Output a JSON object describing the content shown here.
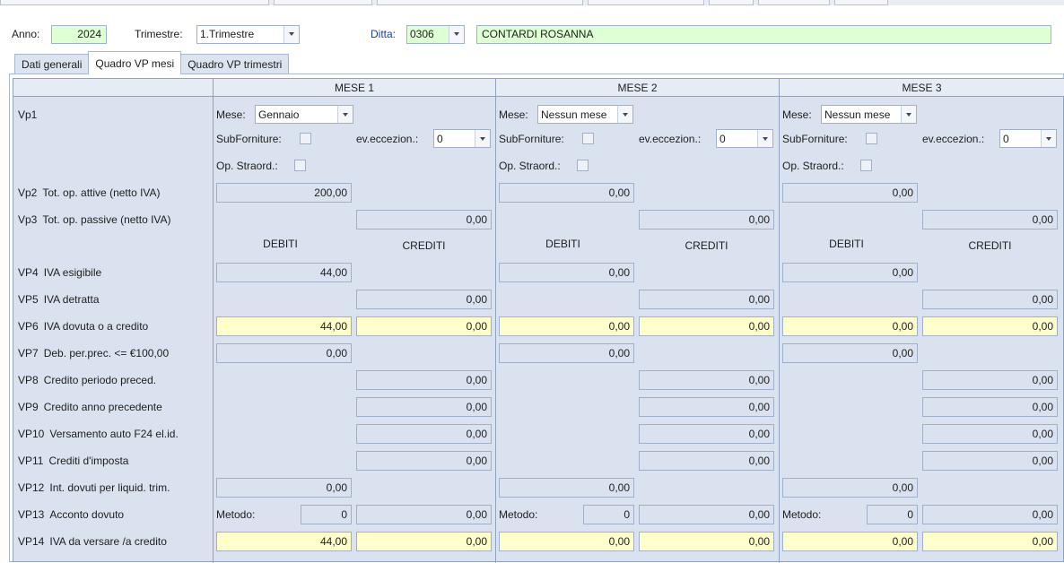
{
  "header": {
    "anno_label": "Anno:",
    "anno_value": "2024",
    "trimestre_label": "Trimestre:",
    "trimestre_value": "1.Trimestre",
    "ditta_label": "Ditta:",
    "ditta_code": "0306",
    "ditta_name": "CONTARDI ROSANNA"
  },
  "tabs": [
    {
      "label": "Dati generali"
    },
    {
      "label": "Quadro VP mesi"
    },
    {
      "label": "Quadro VP trimestri"
    }
  ],
  "active_tab": "Quadro VP mesi",
  "columns": [
    {
      "title": "MESE 1",
      "mese": "Gennaio",
      "eveccezion": "0",
      "metodo": "0",
      "vp2": "200,00",
      "vp3": "0,00",
      "vp4": "44,00",
      "vp5": "0,00",
      "vp6d": "44,00",
      "vp6c": "0,00",
      "vp7": "0,00",
      "vp8": "0,00",
      "vp9": "0,00",
      "vp10": "0,00",
      "vp11": "0,00",
      "vp12": "0,00",
      "vp13": "0,00",
      "vp14d": "44,00",
      "vp14c": "0,00"
    },
    {
      "title": "MESE 2",
      "mese": "Nessun mese",
      "eveccezion": "0",
      "metodo": "0",
      "vp2": "0,00",
      "vp3": "0,00",
      "vp4": "0,00",
      "vp5": "0,00",
      "vp6d": "0,00",
      "vp6c": "0,00",
      "vp7": "0,00",
      "vp8": "0,00",
      "vp9": "0,00",
      "vp10": "0,00",
      "vp11": "0,00",
      "vp12": "0,00",
      "vp13": "0,00",
      "vp14d": "0,00",
      "vp14c": "0,00"
    },
    {
      "title": "MESE 3",
      "mese": "Nessun mese",
      "eveccezion": "0",
      "metodo": "0",
      "vp2": "0,00",
      "vp3": "0,00",
      "vp4": "0,00",
      "vp5": "0,00",
      "vp6d": "0,00",
      "vp6c": "0,00",
      "vp7": "0,00",
      "vp8": "0,00",
      "vp9": "0,00",
      "vp10": "0,00",
      "vp11": "0,00",
      "vp12": "0,00",
      "vp13": "0,00",
      "vp14d": "0,00",
      "vp14c": "0,00"
    }
  ],
  "field_labels": {
    "mese": "Mese:",
    "subforniture": "SubForniture:",
    "eveccezion": "ev.eccezion.:",
    "opstraord": "Op. Straord.:",
    "metodo": "Metodo:",
    "debiti": "DEBITI",
    "crediti": "CREDITI"
  },
  "rows": [
    {
      "code": "Vp1",
      "label": ""
    },
    {
      "code": "Vp2",
      "label": "Tot. op. attive (netto IVA)"
    },
    {
      "code": "Vp3",
      "label": "Tot. op. passive (netto IVA)"
    },
    {
      "code": "VP4",
      "label": "IVA esigibile"
    },
    {
      "code": "VP5",
      "label": "IVA detratta"
    },
    {
      "code": "VP6",
      "label": "IVA dovuta o a credito"
    },
    {
      "code": "VP7",
      "label": "Deb. per.prec. <= €100,00"
    },
    {
      "code": "VP8",
      "label": "Credito periodo preced."
    },
    {
      "code": "VP9",
      "label": "Credito anno precedente"
    },
    {
      "code": "VP10",
      "label": "Versamento auto F24 el.id."
    },
    {
      "code": "VP11",
      "label": "Crediti d'imposta"
    },
    {
      "code": "VP12",
      "label": "Int. dovuti per liquid. trim."
    },
    {
      "code": "VP13",
      "label": "Acconto dovuto"
    },
    {
      "code": "VP14",
      "label": "IVA da versare /a credito"
    }
  ],
  "icons": {
    "dropdown": "chevron-down-icon",
    "checkbox": "checkbox-icon"
  },
  "colors": {
    "green_field": "#dfffd4",
    "yellow_field": "#ffffcc",
    "grid_bg": "#d9e2ee",
    "blue_label": "#1a3d9e"
  }
}
